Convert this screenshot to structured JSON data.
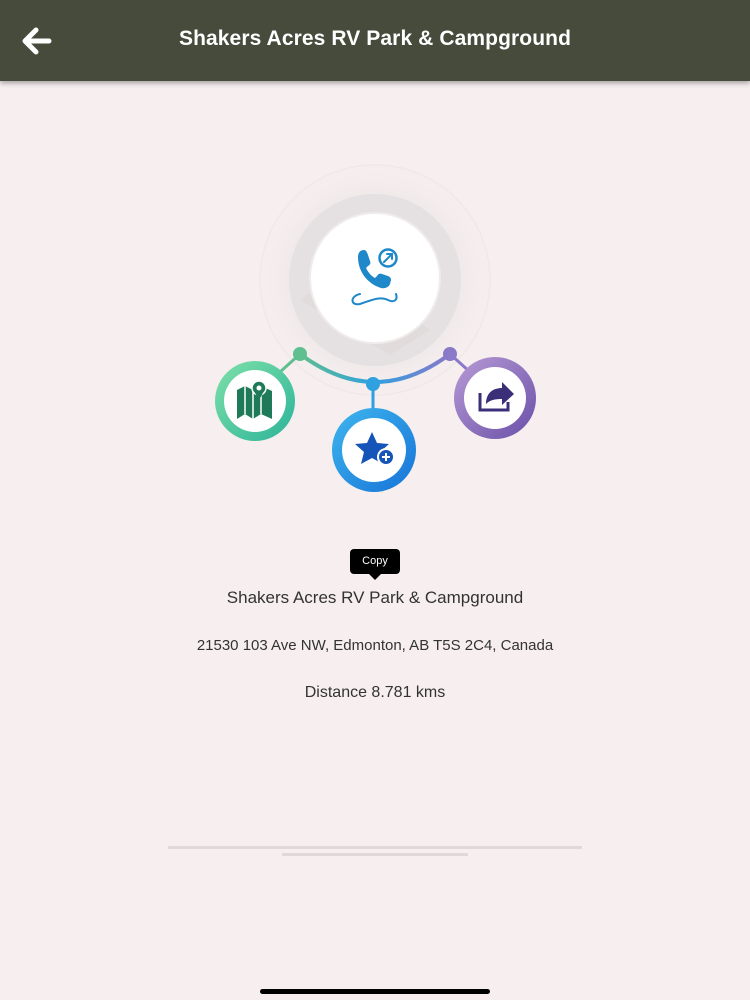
{
  "header": {
    "title": "Shakers Acres RV Park & Campground",
    "back_icon": "back-arrow-icon"
  },
  "actions": {
    "call": {
      "icon": "phone-call-icon",
      "color": "#1e88c8"
    },
    "map": {
      "icon": "map-pin-icon",
      "color": "#1f7a5a"
    },
    "favorite": {
      "icon": "star-add-icon",
      "color": "#1554b8"
    },
    "share": {
      "icon": "share-arrow-icon",
      "color": "#3a2f78"
    }
  },
  "copy_tooltip": "Copy",
  "place": {
    "name": "Shakers Acres RV Park & Campground",
    "address": "21530 103 Ave NW, Edmonton, AB T5S 2C4, Canada",
    "distance": "Distance 8.781 kms"
  },
  "colors": {
    "header_bg": "#464b3c",
    "page_bg": "#f6eeef"
  }
}
